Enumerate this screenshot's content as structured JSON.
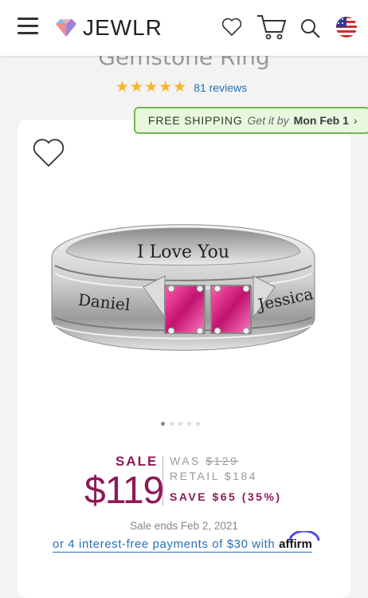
{
  "header": {
    "logo_text": "JEWLR"
  },
  "product": {
    "title_partial": "Gemstone Ring",
    "rating_stars": "★★★★★",
    "reviews": "81 reviews",
    "engraving_top": "I Love You",
    "engraving_left": "Daniel",
    "engraving_right": "Jessica"
  },
  "shipping": {
    "free": "FREE SHIPPING",
    "get_it": "Get it by",
    "date": "Mon Feb 1",
    "chevron": "›"
  },
  "pricing": {
    "sale_label": "SALE",
    "price": "$119",
    "was_label": "WAS",
    "was_price": "$129",
    "retail": "RETAIL $184",
    "save": "SAVE $65 (35%)",
    "sale_ends": "Sale ends Feb 2, 2021",
    "affirm_text": "or 4 interest-free payments of $30 with",
    "affirm_brand": "affirm"
  },
  "carousel": {
    "dots_count": 5,
    "active_index": 0
  },
  "colors": {
    "accent": "#8e1957",
    "link": "#2a6fb3",
    "star": "#f7b52a",
    "ship_bg": "#e9f7df",
    "ship_border": "#74b84e"
  },
  "icons": [
    "menu-icon",
    "heart-icon",
    "cart-icon",
    "search-icon",
    "us-flag-icon"
  ]
}
